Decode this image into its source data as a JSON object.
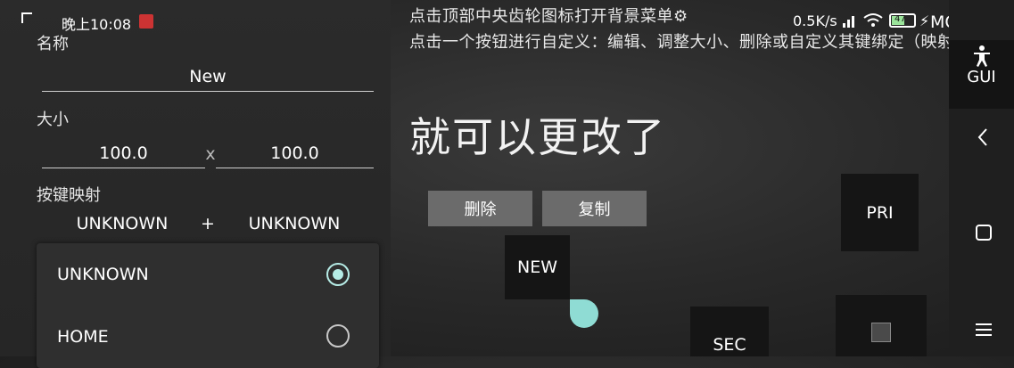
{
  "status_bar": {
    "time": "晚上10:08",
    "speed": "0.5K/s",
    "battery": "47",
    "mode": "MOUSE"
  },
  "instructions": {
    "line1": "点击顶部中央齿轮图标打开背景菜单⚙",
    "line2": "点击一个按钮进行自定义：编辑、调整大小、删除或自定义其键绑定（映射）。",
    "big": "就可以更改了"
  },
  "editor": {
    "name_label": "名称",
    "name_value": "New",
    "size_label": "大小",
    "width_value": "100.0",
    "size_separator": "x",
    "height_value": "100.0",
    "mapping_label": "按键映射",
    "key1": "UNKNOWN",
    "key_plus": "+",
    "key2": "UNKNOWN",
    "options": [
      {
        "label": "UNKNOWN",
        "selected": true
      },
      {
        "label": "HOME",
        "selected": false
      }
    ]
  },
  "actions": {
    "delete": "删除",
    "copy": "复制"
  },
  "keys": {
    "new": "NEW",
    "pri": "PRI",
    "sec": "SEC"
  },
  "nav": {
    "gui": "GUI"
  },
  "colors": {
    "accent": "#b6ece6",
    "handle": "#8fdcd4"
  }
}
